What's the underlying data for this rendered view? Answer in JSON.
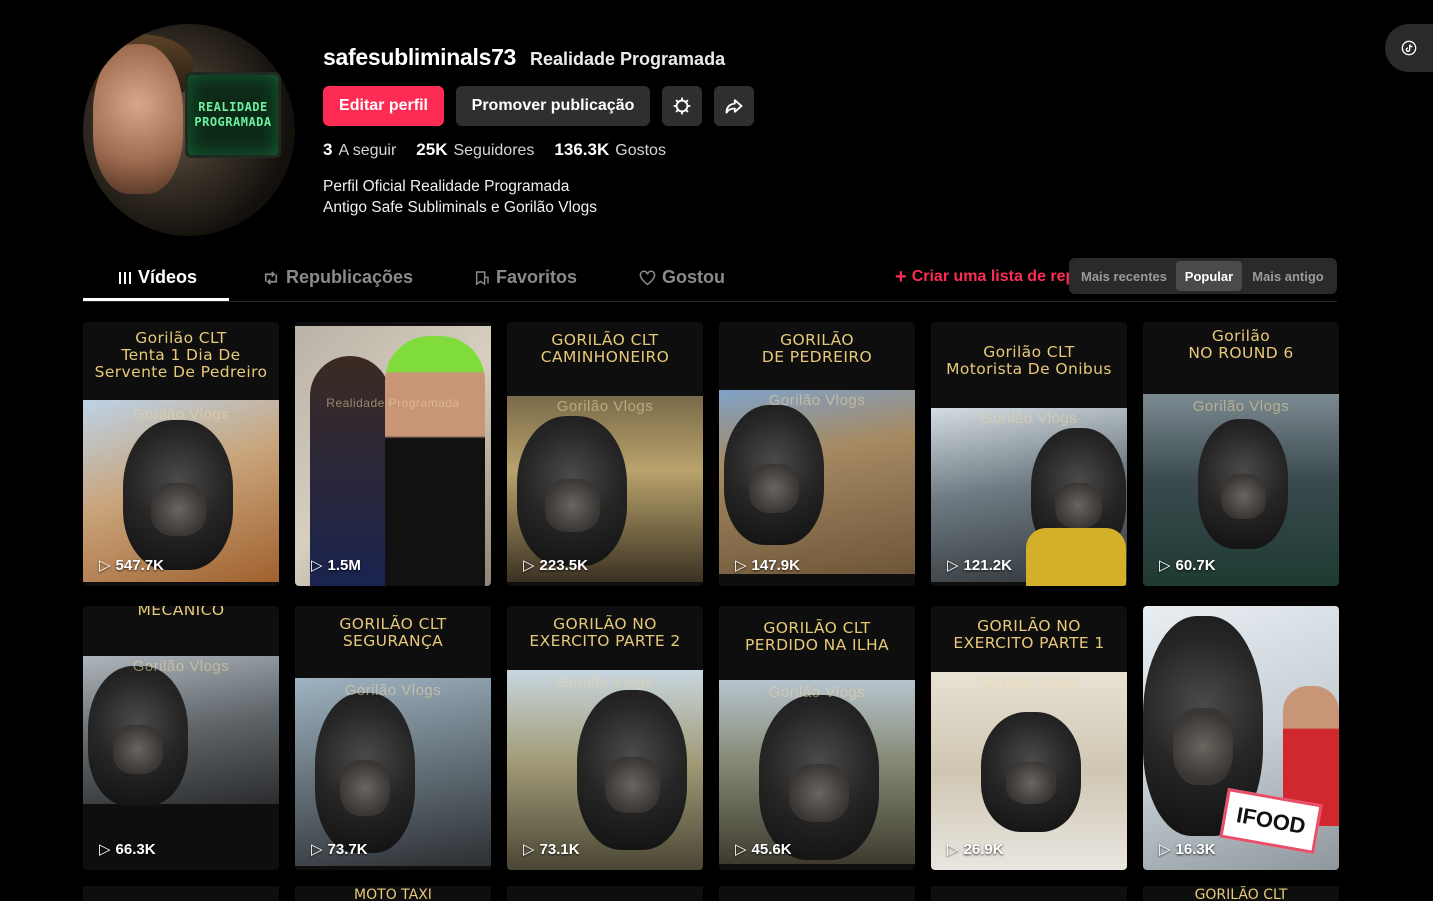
{
  "profile": {
    "username": "safesubliminals73",
    "nickname": "Realidade Programada",
    "avatar_screen_line1": "REALIDADE",
    "avatar_screen_line2": "PROGRAMADA",
    "bio_line1": "Perfil Oficial Realidade Programada",
    "bio_line2": "Antigo Safe Subliminals e Gorilão Vlogs"
  },
  "actions": {
    "edit": "Editar perfil",
    "promote": "Promover publicação",
    "settings_icon": "gear-icon",
    "share_icon": "share-icon"
  },
  "stats": {
    "following": {
      "num": "3",
      "label": "A seguir"
    },
    "followers": {
      "num": "25K",
      "label": "Seguidores"
    },
    "likes": {
      "num": "136.3K",
      "label": "Gostos"
    }
  },
  "tabs": {
    "videos": "Vídeos",
    "reposts": "Republicações",
    "favorites": "Favoritos",
    "liked": "Gostou",
    "create_list": "Criar uma lista de reprodução"
  },
  "sort": {
    "recent": "Mais recentes",
    "popular": "Popular",
    "oldest": "Mais antigo",
    "selected": "Popular"
  },
  "videos": [
    {
      "title1": "Gorilão CLT",
      "title2": "Tenta 1 Dia De",
      "title3": "Servente De Pedreiro",
      "watermark": "Gorilão Vlogs",
      "views": "547.7K"
    },
    {
      "title1": "",
      "title2": "",
      "title3": "",
      "watermark": "Realidade Programada",
      "views": "1.5M"
    },
    {
      "title1": "GORILÃO CLT",
      "title2": "CAMINHONEIRO",
      "title3": "",
      "watermark": "Gorilão Vlogs",
      "views": "223.5K"
    },
    {
      "title1": "GORILÃO",
      "title2": "DE PEDREIRO",
      "title3": "",
      "watermark": "Gorilão Vlogs",
      "views": "147.9K"
    },
    {
      "title1": "Gorilão CLT",
      "title2": "Motorista De Onibus",
      "title3": "",
      "watermark": "Gorilão Vlogs",
      "views": "121.2K"
    },
    {
      "title1": "Gorilão",
      "title2": "NO ROUND 6",
      "title3": "",
      "watermark": "Gorilão Vlogs",
      "views": "60.7K"
    },
    {
      "title1": "MECANICO",
      "title2": "",
      "title3": "",
      "watermark": "Gorilão Vlogs",
      "views": "66.3K"
    },
    {
      "title1": "GORILÃO CLT",
      "title2": "SEGURANÇA",
      "title3": "",
      "watermark": "Gorilão Vlogs",
      "views": "73.7K"
    },
    {
      "title1": "GORILÃO NO",
      "title2": "EXERCITO PARTE 2",
      "title3": "",
      "watermark": "Gorilão Vlogs",
      "views": "73.1K"
    },
    {
      "title1": "GORILÃO CLT",
      "title2": "PERDIDO NA ILHA",
      "title3": "",
      "watermark": "Gorilão Vlogs",
      "views": "45.6K"
    },
    {
      "title1": "GORILÃO NO",
      "title2": "EXERCITO PARTE 1",
      "title3": "",
      "watermark": "Gorilão Vlogs",
      "views": "26.9K"
    },
    {
      "title1": "",
      "title2": "",
      "title3": "",
      "watermark": "",
      "views": "16.3K"
    }
  ],
  "row3_titles": [
    "",
    "MOTO TAXI",
    "",
    "",
    "",
    "GORILÃO CLT"
  ],
  "colors": {
    "accent": "#fe2c55",
    "title_gold": "#e8c979"
  }
}
